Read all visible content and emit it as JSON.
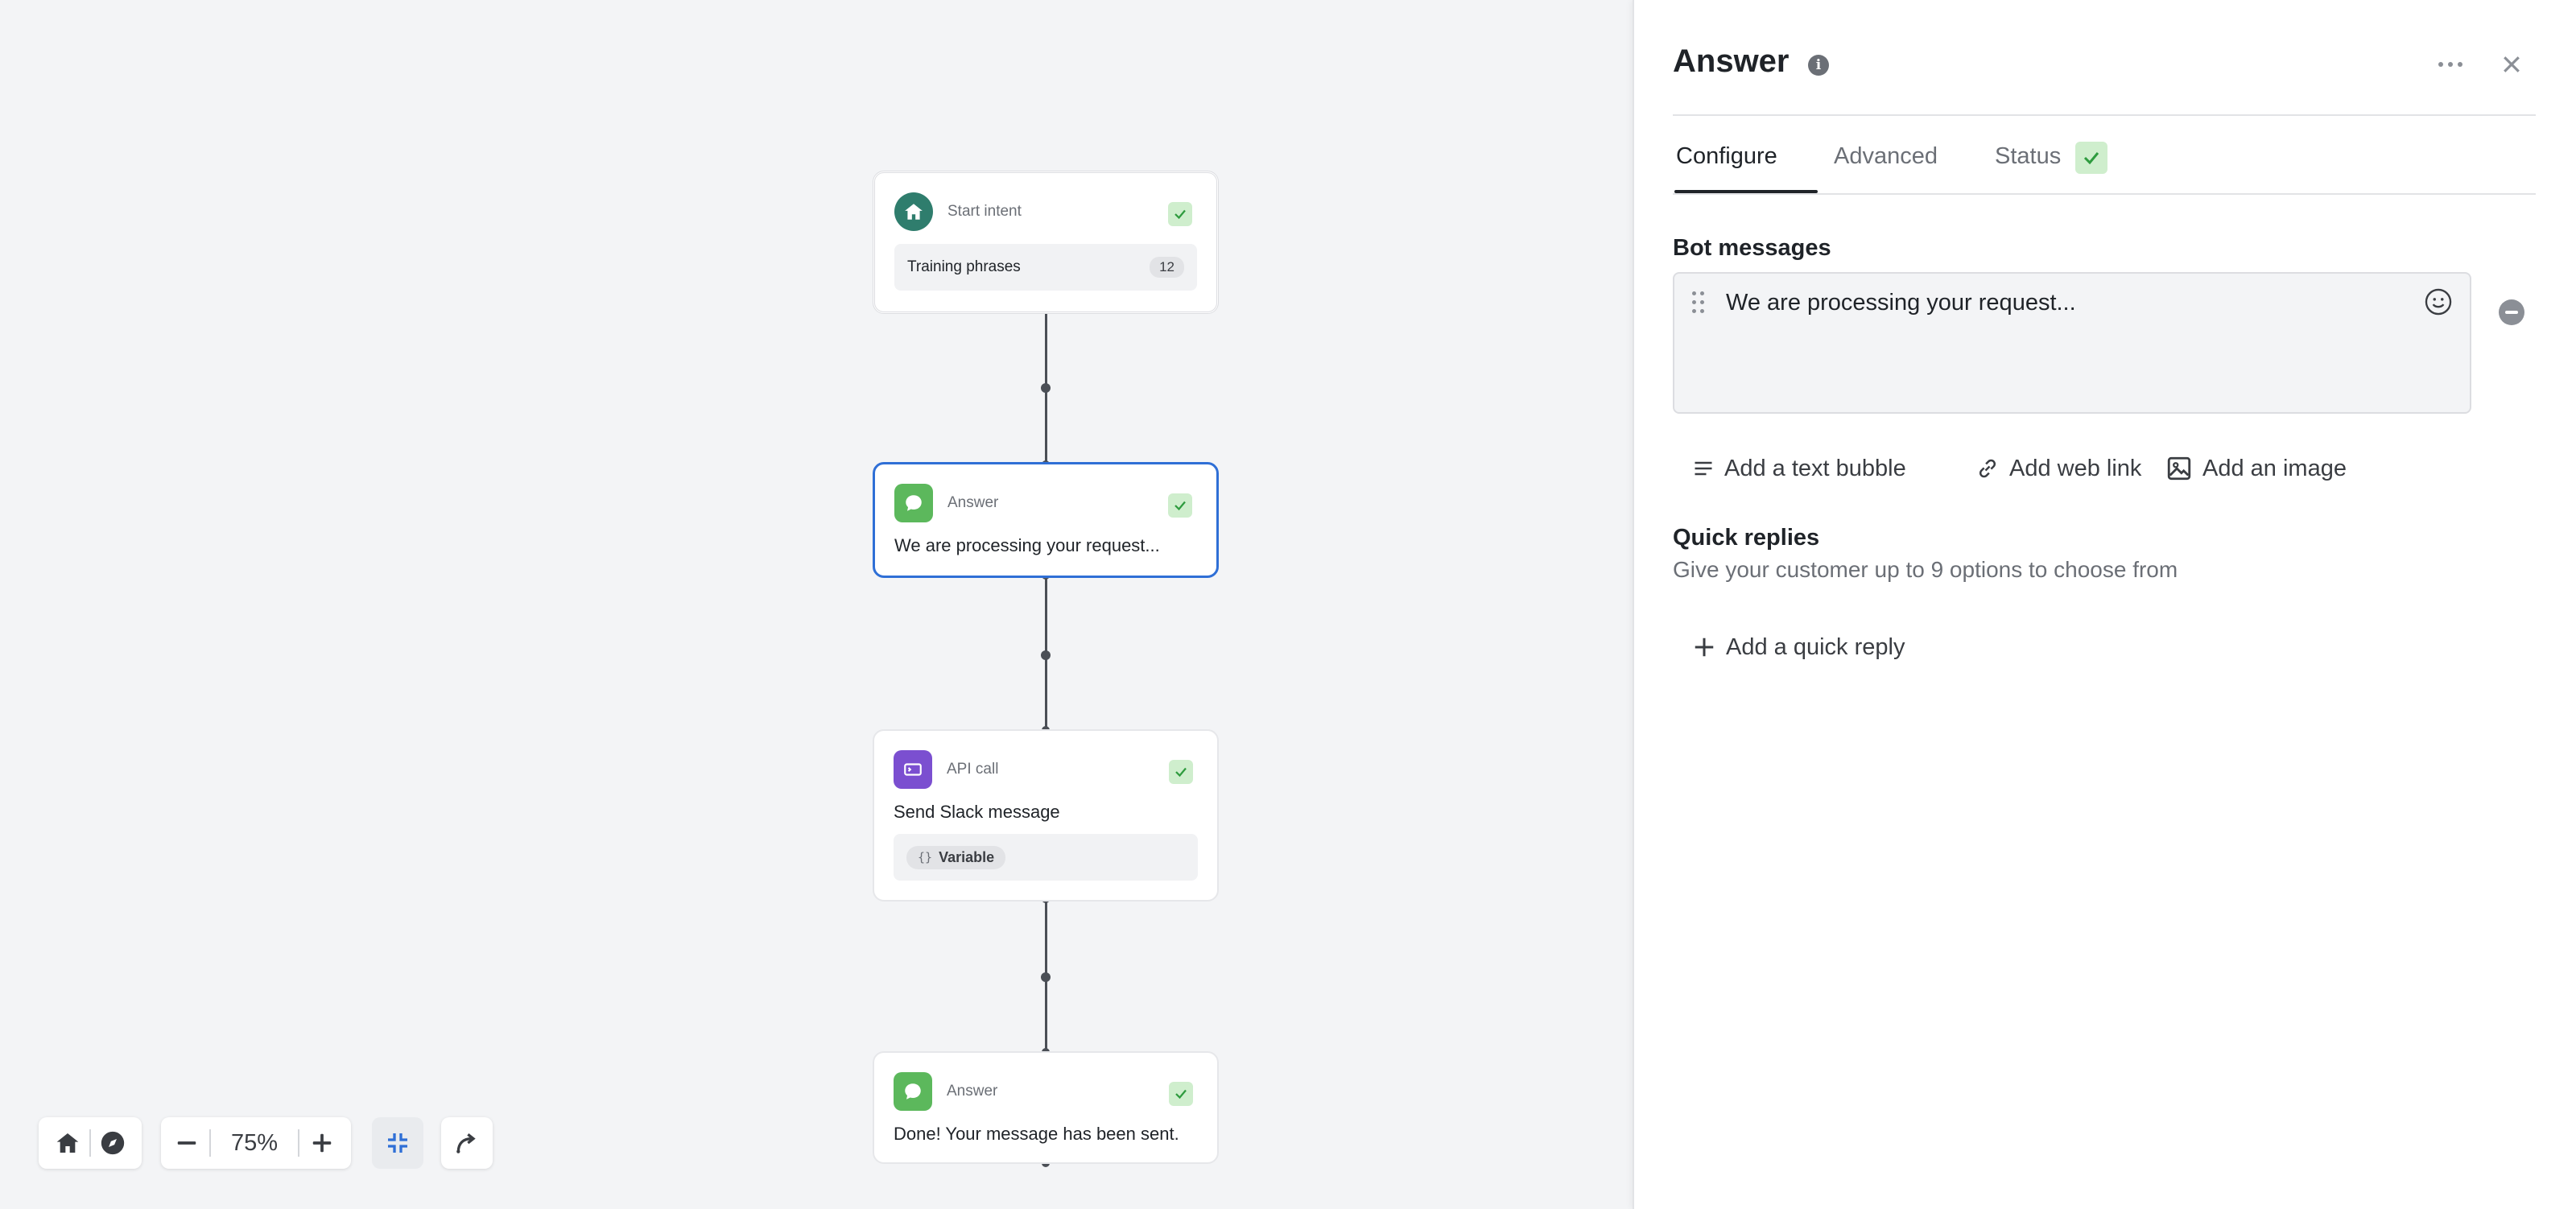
{
  "canvas": {
    "nodes": [
      {
        "type": "Start intent",
        "field_label": "Training phrases",
        "field_count": "12"
      },
      {
        "type": "Answer",
        "text": "We are processing your request..."
      },
      {
        "type": "API call",
        "text": "Send Slack message",
        "chip": "Variable"
      },
      {
        "type": "Answer",
        "text": "Done! Your message has been sent."
      }
    ]
  },
  "toolbar": {
    "zoom": "75%"
  },
  "panel": {
    "title": "Answer",
    "tabs": [
      {
        "label": "Configure"
      },
      {
        "label": "Advanced"
      },
      {
        "label": "Status"
      }
    ],
    "bot_messages": {
      "label": "Bot messages",
      "message": "We are processing your request..."
    },
    "actions": {
      "add_text_bubble": "Add a text bubble",
      "add_web_link": "Add web link",
      "add_image": "Add an image"
    },
    "quick_replies": {
      "label": "Quick replies",
      "description": "Give your customer up to 9 options to choose from",
      "add_label": "Add a quick reply"
    }
  },
  "colors": {
    "accent_blue": "#2f6fd6",
    "status_green": "#cfeecd",
    "check_green": "#2e9b3e",
    "start_teal": "#2f7d6d",
    "answer_green": "#5cb85c",
    "api_purple": "#7b4fd0"
  }
}
